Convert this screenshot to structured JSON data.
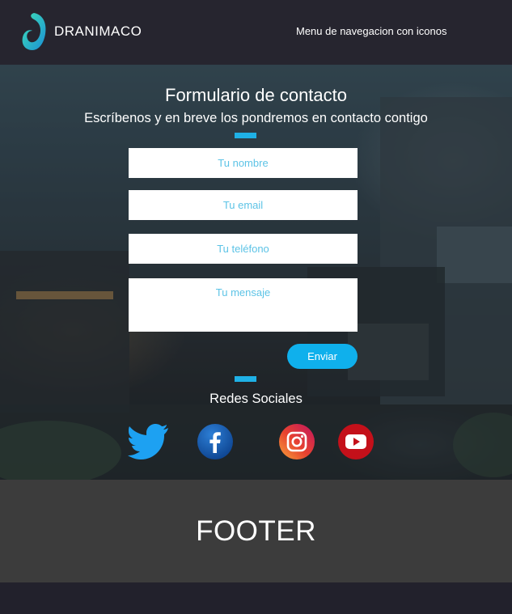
{
  "header": {
    "brand": "DRANIMACO",
    "nav_text": "Menu de navegacion con iconos"
  },
  "contact": {
    "title": "Formulario de contacto",
    "subtitle": "Escríbenos y en breve los pondremos en contacto contigo",
    "name_placeholder": "Tu nombre",
    "email_placeholder": "Tu email",
    "phone_placeholder": "Tu teléfono",
    "message_placeholder": "Tu mensaje",
    "send_label": "Enviar"
  },
  "social": {
    "title": "Redes Sociales",
    "icons": [
      "twitter-icon",
      "facebook-icon",
      "instagram-icon",
      "youtube-icon"
    ]
  },
  "footer": {
    "text": "FOOTER"
  },
  "colors": {
    "accent": "#1fb1e6",
    "header_bg": "#26252f",
    "footer_bg": "#3c3c3c",
    "placeholder": "#5cc3e6"
  }
}
